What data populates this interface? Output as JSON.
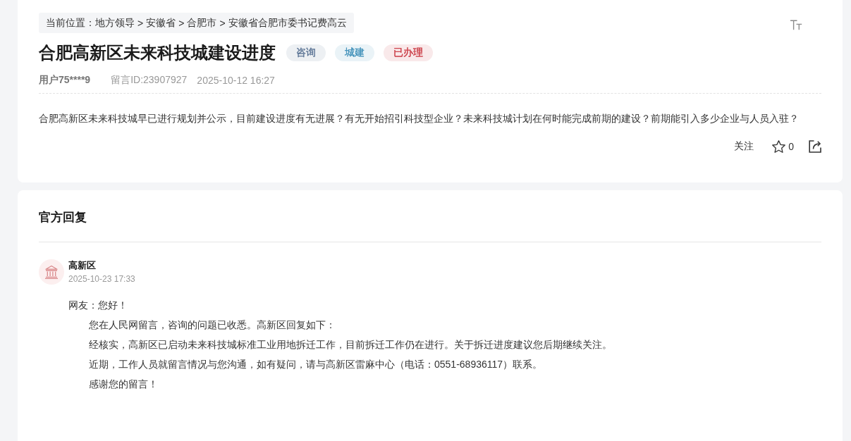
{
  "breadcrumb": [
    {
      "kind": "label",
      "text": "当前位置："
    },
    {
      "kind": "link",
      "text": "地方领导"
    },
    {
      "kind": "sep",
      "text": ">"
    },
    {
      "kind": "link",
      "text": "安徽省"
    },
    {
      "kind": "sep",
      "text": ">"
    },
    {
      "kind": "link",
      "text": "合肥市"
    },
    {
      "kind": "sep",
      "text": ">"
    },
    {
      "kind": "link",
      "text": "安徽省合肥市委书记费高云"
    }
  ],
  "question": {
    "title": "合肥高新区未来科技城建设进度",
    "tags": [
      {
        "label": "咨询",
        "color": "#5a7394"
      },
      {
        "label": "城建",
        "color": "#3d8fb8"
      },
      {
        "label": "已办理",
        "color": "#c8333d"
      }
    ],
    "author": "用户75****9",
    "message_id": "留言ID:23907927",
    "time": "2025-10-12 16:27",
    "body": "合肥高新区未来科技城早已进行规划并公示，目前建设进度有无进展？有无开始招引科技型企业？未来科技城计划在何时能完成前期的建设？前期能引入多少企业与人员入驻？",
    "actions": {
      "follow": "关注",
      "favorites": "0"
    }
  },
  "reply": {
    "heading": "官方回复",
    "department": "高新区",
    "time": "2025-10-23 17:33",
    "greeting": "网友：您好！",
    "paragraphs": [
      "您在人民网留言，咨询的问题已收悉。高新区回复如下：",
      "经核实，高新区已启动未来科技城标准工业用地拆迁工作，目前拆迁工作仍在进行。关于拆迁进度建议您后期继续关注。",
      "近期，工作人员就留言情况与您沟通，如有疑问，请与高新区雷麻中心（电话：0551-68936117）联系。",
      "感谢您的留言！"
    ]
  }
}
